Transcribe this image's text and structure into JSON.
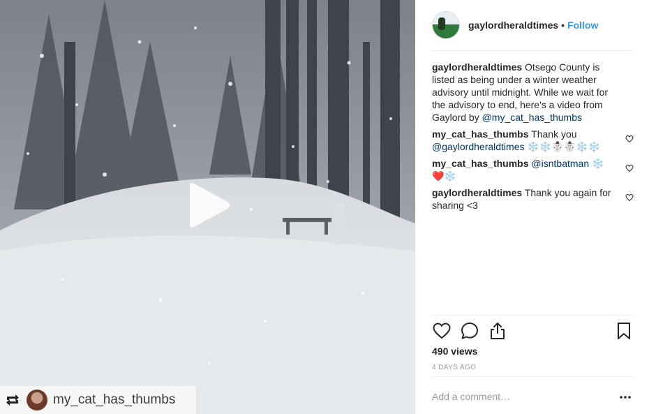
{
  "media": {
    "play_icon": "play-icon",
    "repost": {
      "icon": "repost-icon",
      "username": "my_cat_has_thumbs"
    }
  },
  "header": {
    "username": "gaylordheraldtimes",
    "separator": "•",
    "follow_label": "Follow"
  },
  "caption": {
    "username": "gaylordheraldtimes",
    "text": "Otsego County is listed as being under a winter weather advisory until midnight. While we wait for the advisory to end, here's a video from Gaylord by",
    "mention": "@my_cat_has_thumbs"
  },
  "comments": [
    {
      "username": "my_cat_has_thumbs",
      "text": "Thank you",
      "mention": "@gaylordheraldtimes",
      "emoji": "❄️❄️☃️☃️❄️❄️"
    },
    {
      "username": "my_cat_has_thumbs",
      "text": "",
      "mention": "@isntbatman",
      "emoji": "❄️",
      "emoji2": "❤️❄️"
    },
    {
      "username": "gaylordheraldtimes",
      "text": "Thank you again for sharing <3"
    }
  ],
  "actions": {
    "like_icon": "heart-icon",
    "comment_icon": "comment-icon",
    "share_icon": "share-icon",
    "save_icon": "bookmark-icon"
  },
  "stats": {
    "views": "490 views",
    "time_ago": "4 DAYS AGO"
  },
  "add_comment": {
    "placeholder": "Add a comment…"
  },
  "colors": {
    "link_blue": "#3897f0",
    "mention_blue": "#003569",
    "muted": "#999999",
    "text": "#262626"
  }
}
